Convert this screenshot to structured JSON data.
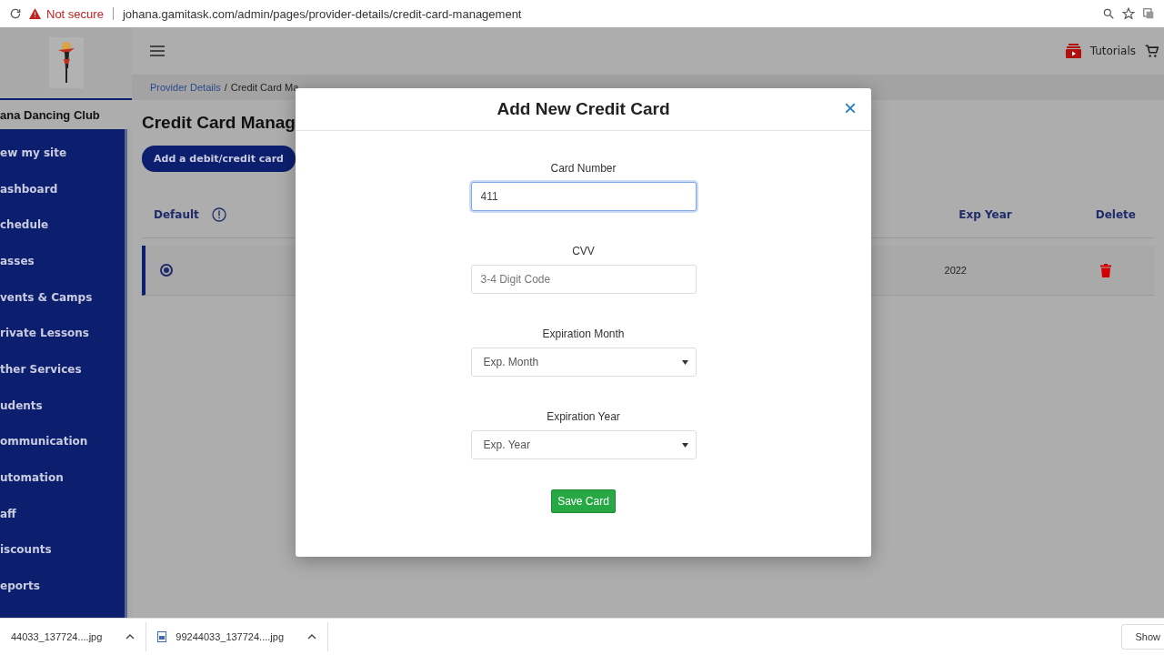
{
  "browser": {
    "security": "Not secure",
    "url": "johana.gamitask.com/admin/pages/provider-details/credit-card-management"
  },
  "sidebar": {
    "club_name": "ana Dancing Club",
    "items": [
      "ew my site",
      "ashboard",
      "chedule",
      "asses",
      "vents & Camps",
      "rivate Lessons",
      "ther Services",
      "udents",
      "ommunication",
      "utomation",
      "aff",
      "iscounts",
      "eports"
    ]
  },
  "header": {
    "tutorials": "Tutorials"
  },
  "breadcrumb": {
    "parent": "Provider Details",
    "separator": "/",
    "current": "Credit Card Ma"
  },
  "page": {
    "title": "Credit Card Manag",
    "add_button": "Add a debit/credit card"
  },
  "table": {
    "columns": [
      "Default",
      "Exp Year",
      "Delete"
    ],
    "rows": [
      {
        "default": true,
        "exp_year": "2022"
      }
    ]
  },
  "modal": {
    "title": "Add New Credit Card",
    "close": "×",
    "fields": [
      {
        "kind": "input",
        "label": "Card Number",
        "value": "411",
        "focused": true
      },
      {
        "kind": "input",
        "label": "CVV",
        "placeholder": "3-4 Digit Code",
        "focused": false
      },
      {
        "kind": "select",
        "label": "Expiration Month",
        "value": "Exp. Month"
      },
      {
        "kind": "select",
        "label": "Expiration Year",
        "value": "Exp. Year"
      }
    ],
    "save_button": "Save Card"
  },
  "downloads": {
    "items": [
      "44033_137724....jpg",
      "99244033_137724....jpg"
    ],
    "show_all": "Show"
  }
}
